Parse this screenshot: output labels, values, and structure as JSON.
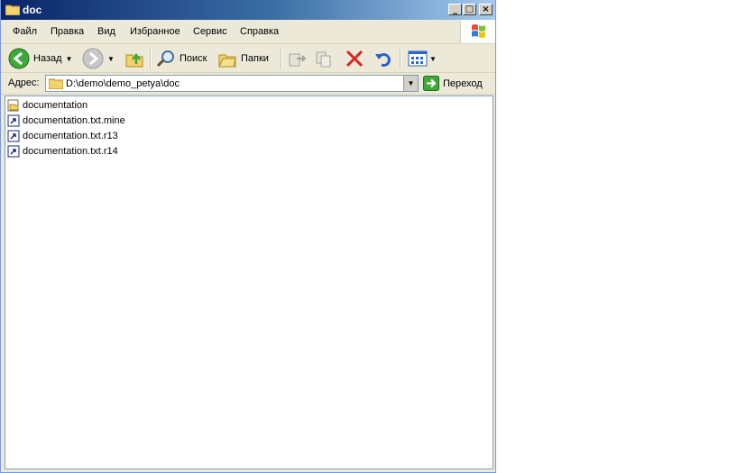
{
  "window": {
    "title": "doc"
  },
  "menubar": {
    "items": [
      "Файл",
      "Правка",
      "Вид",
      "Избранное",
      "Сервис",
      "Справка"
    ]
  },
  "toolbar": {
    "back_label": "Назад",
    "search_label": "Поиск",
    "folders_label": "Папки"
  },
  "address": {
    "label": "Адрес:",
    "value": "D:\\demo\\demo_petya\\doc",
    "go_label": "Переход"
  },
  "files": [
    {
      "name": "documentation",
      "icon": "folder-icon"
    },
    {
      "name": "documentation.txt.mine",
      "icon": "shortcut-file-icon"
    },
    {
      "name": "documentation.txt.r13",
      "icon": "shortcut-file-icon"
    },
    {
      "name": "documentation.txt.r14",
      "icon": "shortcut-file-icon"
    }
  ],
  "colors": {
    "titlebar_start": "#0a246a",
    "titlebar_end": "#a6caf0",
    "chrome": "#ece9d8"
  }
}
